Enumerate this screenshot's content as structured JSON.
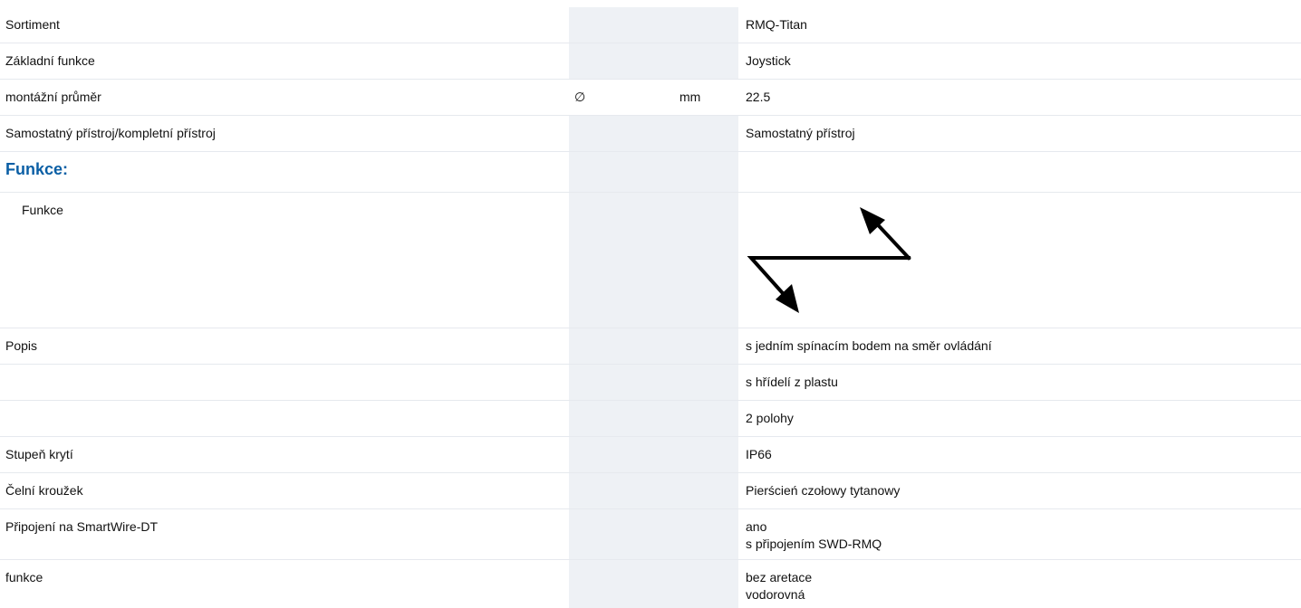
{
  "rows": {
    "sortiment": {
      "label": "Sortiment",
      "value": "RMQ-Titan"
    },
    "zakladni": {
      "label": "Základní funkce",
      "value": "Joystick"
    },
    "prumer": {
      "label": "montážní průměr",
      "symbol": "∅",
      "unit": "mm",
      "value": "22.5"
    },
    "pristroj": {
      "label": "Samostatný přístroj/kompletní přístroj",
      "value": "Samostatný přístroj"
    },
    "section_funkce": {
      "label": "Funkce:"
    },
    "funkce_sub": {
      "label": "Funkce",
      "value_icon": "two-diagonal-arrows-icon"
    },
    "popis": {
      "label": "Popis",
      "value": "s jedním spínacím bodem na směr ovládání"
    },
    "popis2": {
      "value": "s hřídelí z plastu"
    },
    "popis3": {
      "value": "2 polohy"
    },
    "kryti": {
      "label": "Stupeň krytí",
      "value": "IP66"
    },
    "krouzek": {
      "label": "Čelní kroužek",
      "value": "Pierścień czołowy tytanowy"
    },
    "smartwire": {
      "label": "Připojení na SmartWire-DT",
      "value_line1": "ano",
      "value_line2": "s připojením SWD-RMQ"
    },
    "funkce_last": {
      "label": "funkce",
      "value_line1": "bez aretace",
      "value_line2": "vodorovná"
    }
  },
  "colors": {
    "accent": "#0b5fa5",
    "shaded_column": "#eef1f5",
    "row_divider": "#e6e9ee"
  }
}
